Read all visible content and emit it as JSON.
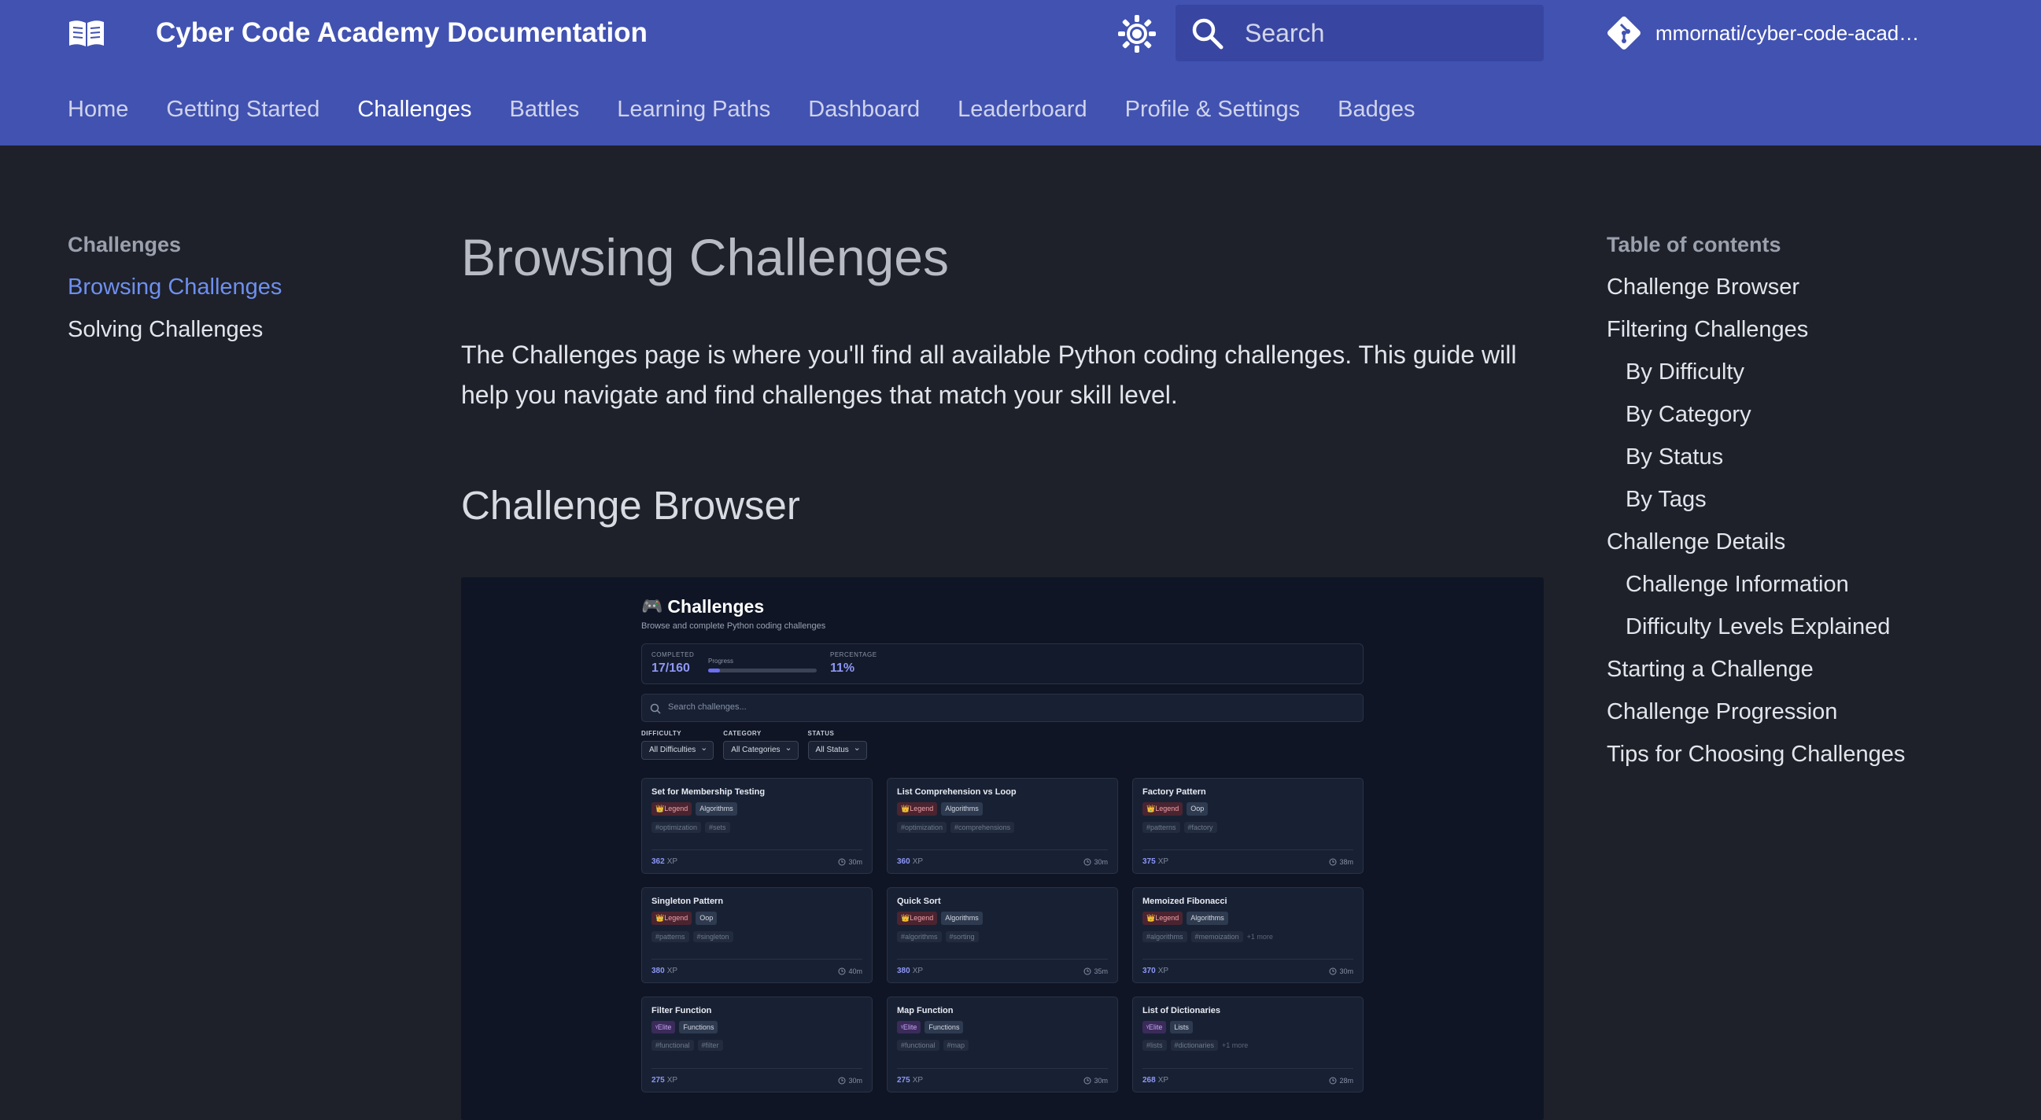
{
  "header": {
    "site_title": "Cyber Code Academy Documentation",
    "search_placeholder": "Search",
    "repo_name": "mmornati/cyber-code-acad…",
    "icons": {
      "logo": "open-book-icon",
      "theme": "brightness-icon",
      "search": "search-icon",
      "repo": "git-icon"
    },
    "brand_color": "#4152b1"
  },
  "tabs": [
    {
      "label": "Home",
      "active": false
    },
    {
      "label": "Getting Started",
      "active": false
    },
    {
      "label": "Challenges",
      "active": true
    },
    {
      "label": "Battles",
      "active": false
    },
    {
      "label": "Learning Paths",
      "active": false
    },
    {
      "label": "Dashboard",
      "active": false
    },
    {
      "label": "Leaderboard",
      "active": false
    },
    {
      "label": "Profile & Settings",
      "active": false
    },
    {
      "label": "Badges",
      "active": false
    }
  ],
  "leftnav": {
    "heading": "Challenges",
    "items": [
      {
        "label": "Browsing Challenges",
        "active": true
      },
      {
        "label": "Solving Challenges",
        "active": false
      }
    ]
  },
  "main": {
    "title": "Browsing Challenges",
    "intro": "The Challenges page is where you'll find all available Python coding challenges. This guide will help you navigate and find challenges that match your skill level.",
    "section_title": "Challenge Browser"
  },
  "figure": {
    "title": "Challenges",
    "subtitle": "Browse and complete Python coding challenges",
    "completed_label": "COMPLETED",
    "completed_value": "17/160",
    "progress_label": "Progress",
    "progress_fraction": 0.11,
    "percentage_label": "PERCENTAGE",
    "percentage_value": "11%",
    "search_placeholder": "Search challenges...",
    "filters": [
      {
        "label": "DIFFICULTY",
        "value": "All Difficulties"
      },
      {
        "label": "CATEGORY",
        "value": "All Categories"
      },
      {
        "label": "STATUS",
        "value": "All Status"
      }
    ],
    "xp_unit": "XP",
    "cards": [
      {
        "title": "Set for Membership Testing",
        "level": "Legend",
        "category": "Algorithms",
        "tags": [
          "#optimization",
          "#sets"
        ],
        "more": "",
        "xp": "362",
        "time": "30m"
      },
      {
        "title": "List Comprehension vs Loop",
        "level": "Legend",
        "category": "Algorithms",
        "tags": [
          "#optimization",
          "#comprehensions"
        ],
        "more": "",
        "xp": "360",
        "time": "30m"
      },
      {
        "title": "Factory Pattern",
        "level": "Legend",
        "category": "Oop",
        "tags": [
          "#patterns",
          "#factory"
        ],
        "more": "",
        "xp": "375",
        "time": "38m"
      },
      {
        "title": "Singleton Pattern",
        "level": "Legend",
        "category": "Oop",
        "tags": [
          "#patterns",
          "#singleton"
        ],
        "more": "",
        "xp": "380",
        "time": "40m"
      },
      {
        "title": "Quick Sort",
        "level": "Legend",
        "category": "Algorithms",
        "tags": [
          "#algorithms",
          "#sorting"
        ],
        "more": "",
        "xp": "380",
        "time": "35m"
      },
      {
        "title": "Memoized Fibonacci",
        "level": "Legend",
        "category": "Algorithms",
        "tags": [
          "#algorithms",
          "#memoization"
        ],
        "more": "+1 more",
        "xp": "370",
        "time": "30m"
      },
      {
        "title": "Filter Function",
        "level": "Elite",
        "category": "Functions",
        "tags": [
          "#functional",
          "#filter"
        ],
        "more": "",
        "xp": "275",
        "time": "30m"
      },
      {
        "title": "Map Function",
        "level": "Elite",
        "category": "Functions",
        "tags": [
          "#functional",
          "#map"
        ],
        "more": "",
        "xp": "275",
        "time": "30m"
      },
      {
        "title": "List of Dictionaries",
        "level": "Elite",
        "category": "Lists",
        "tags": [
          "#lists",
          "#dictionaries"
        ],
        "more": "+1 more",
        "xp": "268",
        "time": "28m"
      }
    ]
  },
  "toc": {
    "title": "Table of contents",
    "items": [
      {
        "label": "Challenge Browser",
        "level": 1
      },
      {
        "label": "Filtering Challenges",
        "level": 1
      },
      {
        "label": "By Difficulty",
        "level": 2
      },
      {
        "label": "By Category",
        "level": 2
      },
      {
        "label": "By Status",
        "level": 2
      },
      {
        "label": "By Tags",
        "level": 2
      },
      {
        "label": "Challenge Details",
        "level": 1
      },
      {
        "label": "Challenge Information",
        "level": 2
      },
      {
        "label": "Difficulty Levels Explained",
        "level": 2
      },
      {
        "label": "Starting a Challenge",
        "level": 1
      },
      {
        "label": "Challenge Progression",
        "level": 1
      },
      {
        "label": "Tips for Choosing Challenges",
        "level": 1
      }
    ]
  }
}
